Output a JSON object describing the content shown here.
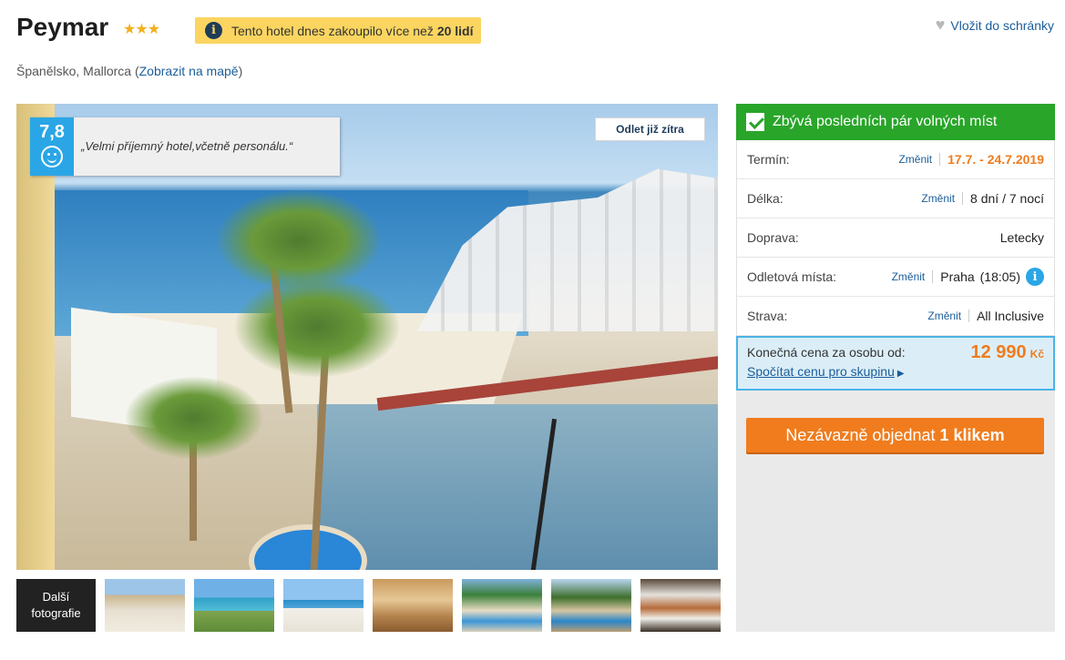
{
  "header": {
    "hotel_name": "Peymar",
    "stars": "★★★",
    "sold_text": "Tento hotel dnes zakoupilo více než",
    "sold_count": "20 lidí",
    "wishlist_label": "Vložit do schránky",
    "location_text": "Španělsko, Mallorca (",
    "map_link": "Zobrazit na mapě",
    "location_close": ")"
  },
  "photo": {
    "rating_score": "7,8",
    "rating_quote": "„Velmi příjemný hotel,včetně personálu.“",
    "departure_tag": "Odlet již zítra"
  },
  "thumbnails": {
    "more_label_1": "Další",
    "more_label_2": "fotografie",
    "count": 7
  },
  "panel": {
    "availability": "Zbývá posledních pár volných míst",
    "rows": [
      {
        "label": "Termín:",
        "change": "Změnit",
        "value": "17.7. - 24.7.2019"
      },
      {
        "label": "Délka:",
        "change": "Změnit",
        "value": "8 dní / 7 nocí"
      },
      {
        "label": "Doprava:",
        "change": "",
        "value": "Letecky"
      },
      {
        "label": "Odletová místa:",
        "change": "Změnit",
        "value": "Praha",
        "value_extra": "(18:05)"
      },
      {
        "label": "Strava:",
        "change": "Změnit",
        "value": "All Inclusive"
      }
    ],
    "price_label": "Konečná cena za osobu od:",
    "price_value": "12 990",
    "price_currency": "Kč",
    "group_link": "Spočítat cenu pro skupinu",
    "order_button": "Nezávazně objednat",
    "order_button_bold": "1 klikem"
  },
  "colors": {
    "accent_orange": "#f07c1d",
    "green": "#29a52a",
    "blue": "#2aa6e6",
    "badge_yellow": "#fbd560"
  }
}
